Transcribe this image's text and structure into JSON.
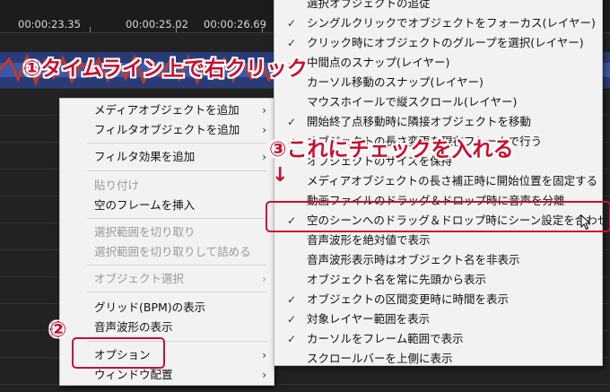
{
  "ruler": {
    "times": [
      "00:00:23.35",
      "00:00:25.02",
      "00:00:26.69"
    ]
  },
  "context_menu": {
    "items": [
      {
        "label": "メディアオブジェクトを追加",
        "submenu": true,
        "disabled": false
      },
      {
        "label": "フィルタオブジェクトを追加",
        "submenu": true,
        "disabled": false
      },
      {
        "label": "フィルタ効果を追加",
        "submenu": true,
        "disabled": false
      },
      {
        "label": "貼り付け",
        "submenu": false,
        "disabled": true
      },
      {
        "label": "空のフレームを挿入",
        "submenu": false,
        "disabled": false
      },
      {
        "label": "選択範囲を切り取り",
        "submenu": false,
        "disabled": true
      },
      {
        "label": "選択範囲を切り取りして詰める",
        "submenu": false,
        "disabled": true
      },
      {
        "label": "オブジェクト選択",
        "submenu": true,
        "disabled": true
      },
      {
        "label": "グリッド(BPM)の表示",
        "submenu": false,
        "disabled": false
      },
      {
        "label": "音声波形の表示",
        "submenu": false,
        "disabled": false
      },
      {
        "label": "オプション",
        "submenu": true,
        "disabled": false
      },
      {
        "label": "ウィンドウ配置",
        "submenu": true,
        "disabled": false
      }
    ]
  },
  "options_submenu": {
    "items": [
      {
        "label": "選択オブジェクトの追従",
        "checked": false
      },
      {
        "label": "シングルクリックでオブジェクトをフォーカス(レイヤー)",
        "checked": true
      },
      {
        "label": "クリック時にオブジェクトのグループを選択(レイヤー)",
        "checked": true
      },
      {
        "label": "中間点のスナップ(レイヤー)",
        "checked": true
      },
      {
        "label": "カーソル移動のスナップ(レイヤー)",
        "checked": false
      },
      {
        "label": "マウスホイールで縦スクロール(レイヤー)",
        "checked": false
      },
      {
        "label": "開始終了点移動時に隣接オブジェクトを移動",
        "checked": true
      },
      {
        "label": "オブジェクトの長さ変更を現在フレームで行う",
        "checked": true
      },
      {
        "label": "オブジェクトのサイズを保持",
        "checked": false
      },
      {
        "label": "メディアオブジェクトの長さ補正時に開始位置を固定する",
        "checked": false
      },
      {
        "label": "動画ファイルのドラッグ＆ドロップ時に音声を分離",
        "checked": false
      },
      {
        "label": "空のシーンへのドラッグ＆ドロップ時にシーン設定を合わせる",
        "checked": true
      },
      {
        "label": "音声波形を絶対値で表示",
        "checked": false
      },
      {
        "label": "音声波形表示時はオブジェクト名を非表示",
        "checked": false
      },
      {
        "label": "オブジェクト名を常に先頭から表示",
        "checked": false
      },
      {
        "label": "オブジェクトの区間変更時に時間を表示",
        "checked": true
      },
      {
        "label": "対象レイヤー範囲を表示",
        "checked": true
      },
      {
        "label": "カーソルをフレーム範囲で表示",
        "checked": true
      },
      {
        "label": "スクロールバーを上側に表示",
        "checked": false
      }
    ]
  },
  "annotations": {
    "step1": "①タイムライン上で右クリック",
    "step2": "②",
    "step3": "③これにチェックを入れる",
    "arrow": "↓"
  },
  "colors": {
    "accent": "#c8102e",
    "menu_bg": "#f2f2f2",
    "timeline_bg": "#1c1c1c",
    "waveform_red": "#c0392b",
    "waveform_blue": "#3a58a8"
  }
}
